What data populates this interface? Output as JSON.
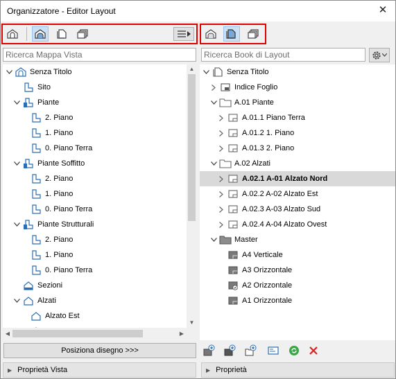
{
  "window": {
    "title": "Organizzatore - Editor Layout",
    "close_glyph": "✕"
  },
  "left": {
    "search_placeholder": "Ricerca Mappa Vista",
    "place_button": "Posiziona disegno >>>",
    "properties_label": "Proprietà Vista",
    "tree": [
      {
        "label": "Senza Titolo",
        "depth": 0,
        "arrow": "down",
        "icon": "project-map-icon"
      },
      {
        "label": "Sito",
        "depth": 1,
        "arrow": "",
        "icon": "story-icon"
      },
      {
        "label": "Piante",
        "depth": 1,
        "arrow": "down",
        "icon": "stories-folder-icon"
      },
      {
        "label": "2. Piano",
        "depth": 2,
        "arrow": "",
        "icon": "story-icon"
      },
      {
        "label": "1. Piano",
        "depth": 2,
        "arrow": "",
        "icon": "story-icon"
      },
      {
        "label": "0. Piano Terra",
        "depth": 2,
        "arrow": "",
        "icon": "story-icon"
      },
      {
        "label": "Piante Soffitto",
        "depth": 1,
        "arrow": "down",
        "icon": "stories-folder-icon"
      },
      {
        "label": "2. Piano",
        "depth": 2,
        "arrow": "",
        "icon": "story-icon"
      },
      {
        "label": "1. Piano",
        "depth": 2,
        "arrow": "",
        "icon": "story-icon"
      },
      {
        "label": "0. Piano Terra",
        "depth": 2,
        "arrow": "",
        "icon": "story-icon"
      },
      {
        "label": "Piante Strutturali",
        "depth": 1,
        "arrow": "down",
        "icon": "stories-folder-icon"
      },
      {
        "label": "2. Piano",
        "depth": 2,
        "arrow": "",
        "icon": "story-icon"
      },
      {
        "label": "1. Piano",
        "depth": 2,
        "arrow": "",
        "icon": "story-icon"
      },
      {
        "label": "0. Piano Terra",
        "depth": 2,
        "arrow": "",
        "icon": "story-icon"
      },
      {
        "label": "Sezioni",
        "depth": 1,
        "arrow": "",
        "icon": "section-icon"
      },
      {
        "label": "Alzati",
        "depth": 1,
        "arrow": "down",
        "icon": "elevation-icon"
      },
      {
        "label": "Alzato Est",
        "depth": 2,
        "arrow": "",
        "icon": "elevation-icon"
      },
      {
        "label": "",
        "depth": 2,
        "arrow": "",
        "icon": "elevation-icon"
      }
    ]
  },
  "right": {
    "search_placeholder": "Ricerca Book di Layout",
    "properties_label": "Proprietà",
    "tree": [
      {
        "label": "Senza Titolo",
        "depth": 0,
        "arrow": "down",
        "icon": "layout-book-icon",
        "bold": false,
        "selected": false
      },
      {
        "label": "Indice Foglio",
        "depth": 1,
        "arrow": "right",
        "icon": "index-icon",
        "bold": false,
        "selected": false
      },
      {
        "label": "A.01 Piante",
        "depth": 1,
        "arrow": "down",
        "icon": "folder-icon",
        "bold": false,
        "selected": false
      },
      {
        "label": "A.01.1 Piano Terra",
        "depth": 2,
        "arrow": "right",
        "icon": "layout-icon",
        "bold": false,
        "selected": false
      },
      {
        "label": "A.01.2 1. Piano",
        "depth": 2,
        "arrow": "right",
        "icon": "layout-icon",
        "bold": false,
        "selected": false
      },
      {
        "label": "A.01.3 2. Piano",
        "depth": 2,
        "arrow": "right",
        "icon": "layout-icon",
        "bold": false,
        "selected": false
      },
      {
        "label": "A.02 Alzati",
        "depth": 1,
        "arrow": "down",
        "icon": "folder-icon",
        "bold": false,
        "selected": false
      },
      {
        "label": "A.02.1 A-01 Alzato Nord",
        "depth": 2,
        "arrow": "right",
        "icon": "layout-icon",
        "bold": true,
        "selected": true
      },
      {
        "label": "A.02.2 A-02 Alzato Est",
        "depth": 2,
        "arrow": "right",
        "icon": "layout-icon",
        "bold": false,
        "selected": false
      },
      {
        "label": "A.02.3 A-03 Alzato Sud",
        "depth": 2,
        "arrow": "right",
        "icon": "layout-icon",
        "bold": false,
        "selected": false
      },
      {
        "label": "A.02.4 A-04 Alzato Ovest",
        "depth": 2,
        "arrow": "right",
        "icon": "layout-icon",
        "bold": false,
        "selected": false
      },
      {
        "label": "Master",
        "depth": 1,
        "arrow": "down",
        "icon": "master-folder-icon",
        "bold": false,
        "selected": false
      },
      {
        "label": "A4 Verticale",
        "depth": 2,
        "arrow": "",
        "icon": "master-icon",
        "bold": false,
        "selected": false
      },
      {
        "label": "A3 Orizzontale",
        "depth": 2,
        "arrow": "",
        "icon": "master-icon",
        "bold": false,
        "selected": false
      },
      {
        "label": "A2 Orizzontale",
        "depth": 2,
        "arrow": "",
        "icon": "master-check-icon",
        "bold": false,
        "selected": false
      },
      {
        "label": "A1 Orizzontale",
        "depth": 2,
        "arrow": "",
        "icon": "master-icon",
        "bold": false,
        "selected": false
      }
    ]
  },
  "colors": {
    "highlight_border": "#e00000",
    "accent": "#2a6db4",
    "selected_row": "#d9d9d9"
  }
}
